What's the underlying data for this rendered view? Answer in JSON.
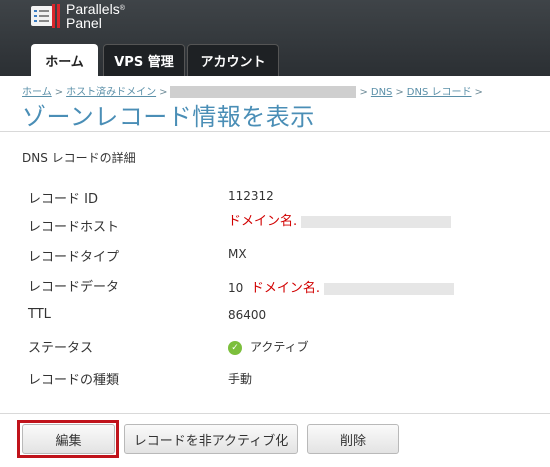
{
  "app": {
    "logo_line1": "Parallels",
    "logo_line2": "Panel",
    "logo_mark": "®"
  },
  "tabs": [
    {
      "label": "ホーム",
      "active": true
    },
    {
      "label": "VPS 管理",
      "active": false
    },
    {
      "label": "アカウント",
      "active": false
    }
  ],
  "breadcrumb": {
    "home": "ホーム",
    "hosted_domains": "ホスト済みドメイン",
    "dns": "DNS",
    "dns_records": "DNS レコード",
    "separator": ">"
  },
  "page": {
    "title": "ゾーンレコード情報を表示",
    "section_title": "DNS レコードの詳細"
  },
  "details": {
    "record_id": {
      "label": "レコード ID",
      "value": "112312"
    },
    "record_host": {
      "label": "レコードホスト",
      "value": "ドメイン名."
    },
    "record_type": {
      "label": "レコードタイプ",
      "value": "MX"
    },
    "record_data": {
      "label": "レコードデータ",
      "priority": "10",
      "value": "ドメイン名."
    },
    "ttl": {
      "label": "TTL",
      "value": "86400"
    },
    "status": {
      "label": "ステータス",
      "value": "アクティブ",
      "icon": "check-circle-icon",
      "color": "#7cbf3c"
    },
    "record_kind": {
      "label": "レコードの種類",
      "value": "手動"
    }
  },
  "buttons": {
    "edit": "編集",
    "deactivate": "レコードを非アクティブ化",
    "delete": "削除"
  },
  "colors": {
    "title": "#4a8eb6",
    "link": "#5a8fa8",
    "highlight": "#c0131b",
    "note": "#d10000"
  }
}
